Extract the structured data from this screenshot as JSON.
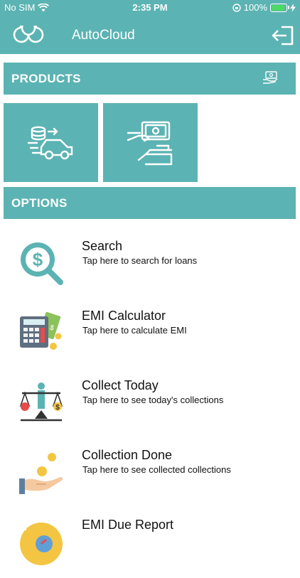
{
  "status": {
    "carrier": "No SIM",
    "time": "2:35 PM",
    "battery": "100%"
  },
  "header": {
    "title": "AutoCloud"
  },
  "products": {
    "label": "PRODUCTS"
  },
  "options_section": {
    "label": "OPTIONS"
  },
  "options": [
    {
      "title": "Search",
      "subtitle": "Tap here to search for loans",
      "icon": "search-dollar-icon"
    },
    {
      "title": "EMI Calculator",
      "subtitle": "Tap here to calculate EMI",
      "icon": "calculator-icon"
    },
    {
      "title": "Collect Today",
      "subtitle": "Tap here to see today's collections",
      "icon": "scale-icon"
    },
    {
      "title": "Collection Done",
      "subtitle": "Tap here to see collected collections",
      "icon": "coins-hand-icon"
    },
    {
      "title": "EMI Due Report",
      "subtitle": "",
      "icon": "due-report-icon"
    }
  ],
  "colors": {
    "accent": "#5cb3b3",
    "text": "#111111"
  }
}
